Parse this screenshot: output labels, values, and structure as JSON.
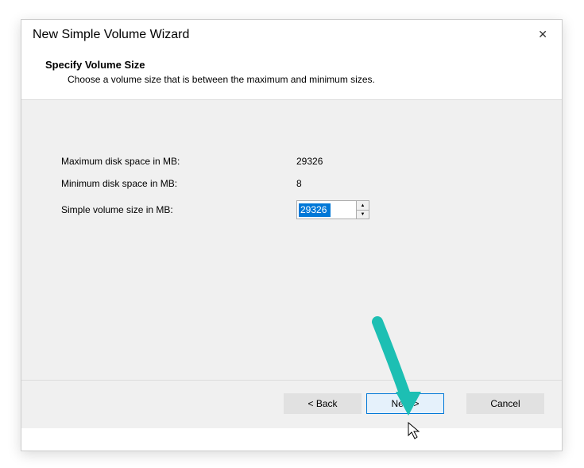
{
  "window": {
    "title": "New Simple Volume Wizard"
  },
  "header": {
    "title": "Specify Volume Size",
    "subtitle": "Choose a volume size that is between the maximum and minimum sizes."
  },
  "fields": {
    "max_label": "Maximum disk space in MB:",
    "max_value": "29326",
    "min_label": "Minimum disk space in MB:",
    "min_value": "8",
    "size_label": "Simple volume size in MB:",
    "size_value": "29326"
  },
  "buttons": {
    "back": "< Back",
    "next": "Next >",
    "cancel": "Cancel"
  },
  "colors": {
    "selection": "#0078d7",
    "arrow": "#1dbfb3"
  }
}
